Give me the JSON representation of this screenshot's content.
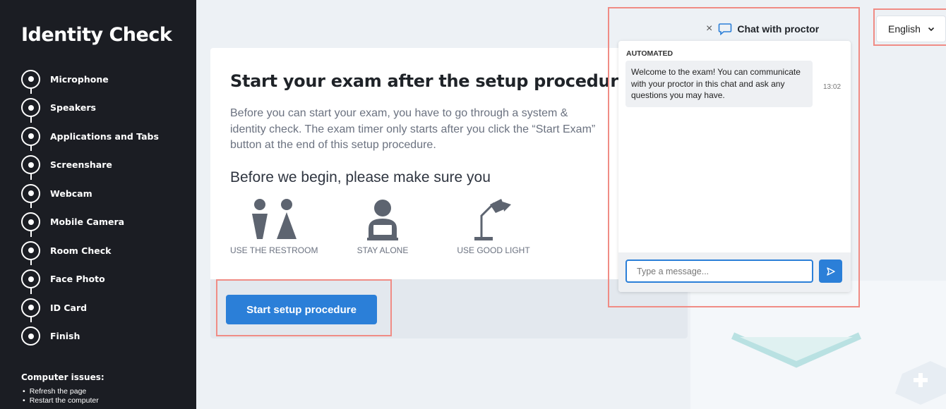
{
  "sidebar": {
    "title": "Identity Check",
    "steps": [
      "Microphone",
      "Speakers",
      "Applications and Tabs",
      "Screenshare",
      "Webcam",
      "Mobile Camera",
      "Room Check",
      "Face Photo",
      "ID Card",
      "Finish"
    ],
    "issues": {
      "heading": "Computer issues:",
      "items": [
        "Refresh the page",
        "Restart the computer"
      ]
    }
  },
  "main": {
    "title": "Start your exam after the setup procedure",
    "intro": "Before you can start your exam, you have to go through a system & identity check. The exam timer only starts after you click the “Start Exam” button at the end of this setup procedure.",
    "subtitle": "Before we begin, please make sure you",
    "requirements": [
      {
        "label": "USE THE RESTROOM",
        "icon": "restroom-icon"
      },
      {
        "label": "STAY ALONE",
        "icon": "person-laptop-icon"
      },
      {
        "label": "USE GOOD LIGHT",
        "icon": "desk-lamp-icon"
      }
    ],
    "start_button": "Start setup procedure"
  },
  "chat": {
    "close_symbol": "×",
    "header": "Chat with proctor",
    "tag": "AUTOMATED",
    "message": "Welcome to the exam! You can communicate with your proctor in this chat and ask any questions you may have.",
    "time": "13:02",
    "input_placeholder": "Type a message..."
  },
  "language": {
    "selected": "English"
  },
  "colors": {
    "sidebar_bg": "#1b1d23",
    "accent": "#2b7fd8",
    "highlight": "#f08c85",
    "icon_gray": "#5d6470"
  }
}
